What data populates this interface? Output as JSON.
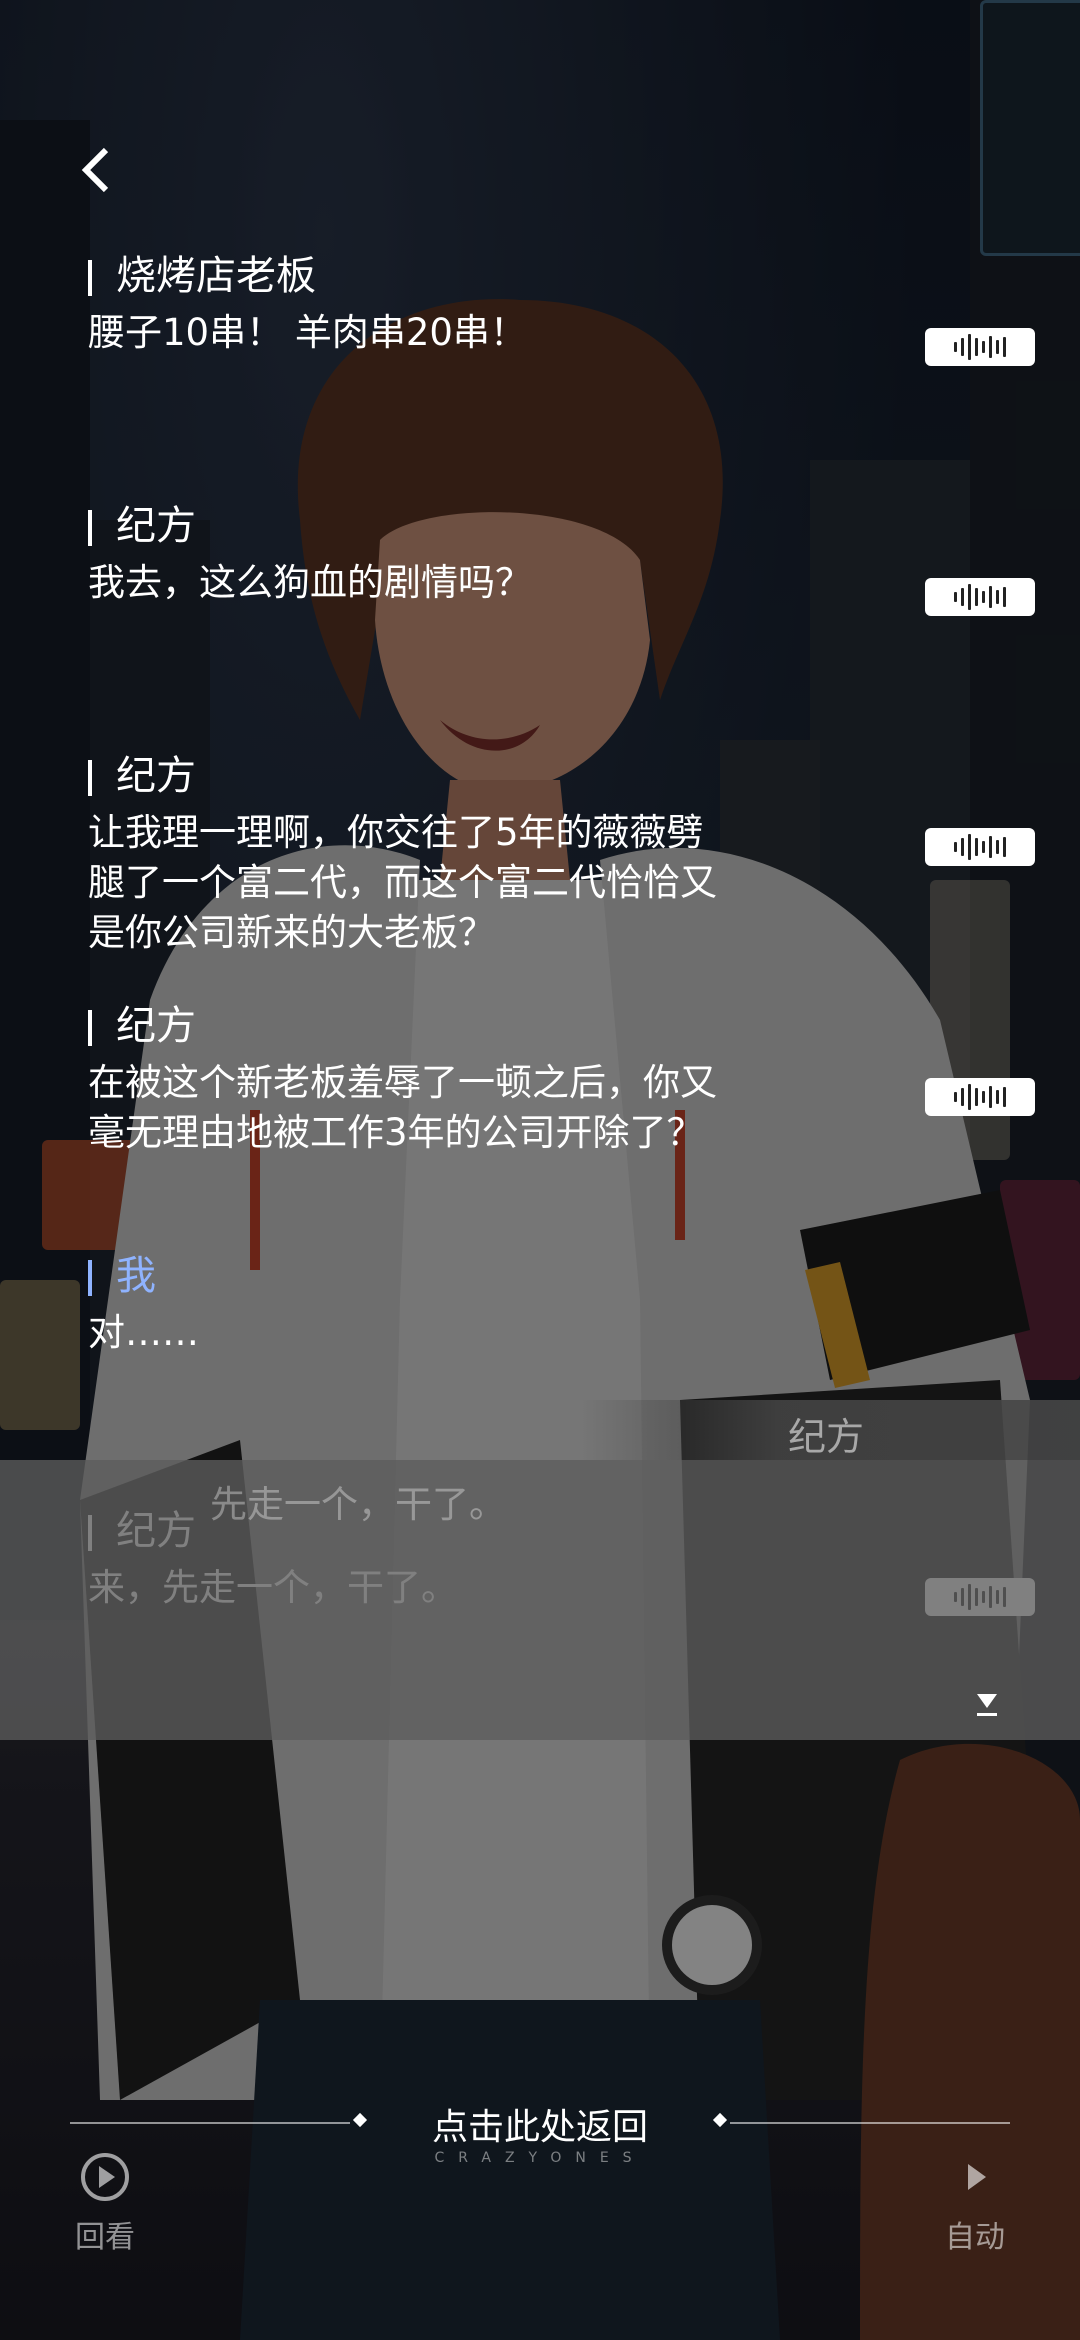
{
  "log": [
    {
      "speaker": "烧烤店老板",
      "text": "腰子10串！ 羊肉串20串！",
      "is_player": false
    },
    {
      "speaker": "纪方",
      "text": "我去，这么狗血的剧情吗？",
      "is_player": false
    },
    {
      "speaker": "纪方",
      "text": "让我理一理啊，你交往了5年的薇薇劈\n腿了一个富二代，而这个富二代恰恰又\n是你公司新来的大老板？",
      "is_player": false
    },
    {
      "speaker": "纪方",
      "text": "在被这个新老板羞辱了一顿之后，你又\n毫无理由地被工作3年的公司开除了？",
      "is_player": false
    },
    {
      "speaker": "我",
      "text": "对……",
      "is_player": true
    },
    {
      "speaker": "纪方",
      "text": "来，先走一个，干了。",
      "is_player": false
    }
  ],
  "dialog": {
    "speaker": "纪方",
    "background_text": "先走一个，干了。"
  },
  "controls": {
    "return_label": "点击此处返回",
    "brand": "CRAZYONES",
    "replay_label": "回看",
    "auto_label": "自动"
  },
  "icons": {
    "back": "chevron-left-icon",
    "voice": "voice-wave-icon",
    "next": "next-arrow-icon",
    "replay": "replay-icon",
    "auto": "play-icon"
  },
  "colors": {
    "player_name": "#8fb3ff",
    "dialog_box": "#5c5c5c",
    "text": "#ffffff"
  }
}
